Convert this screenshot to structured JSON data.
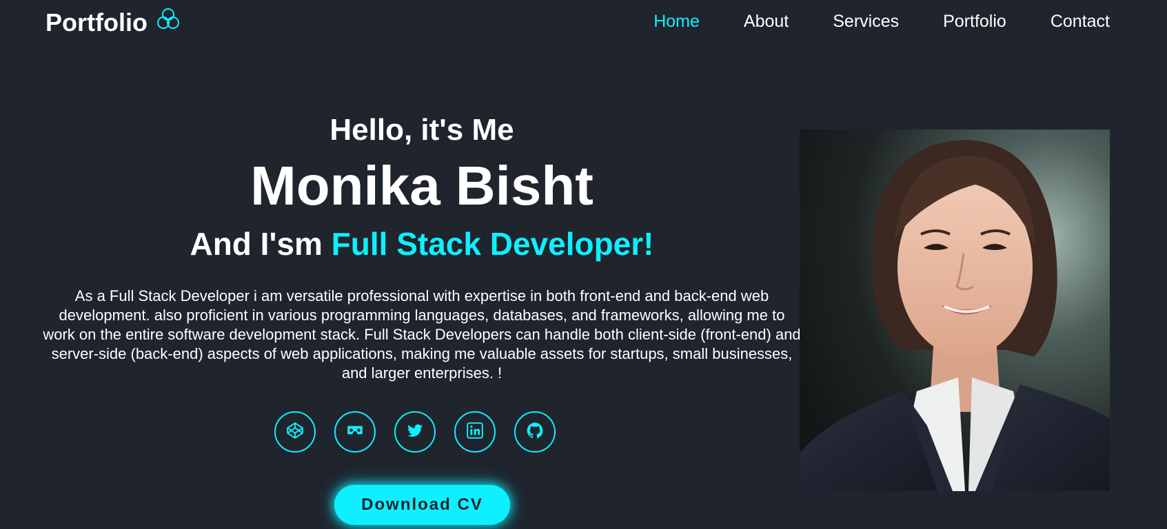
{
  "header": {
    "logo_text": "Portfolio",
    "logo_icon": "codepen-knot-icon",
    "nav": [
      {
        "label": "Home",
        "active": true
      },
      {
        "label": "About",
        "active": false
      },
      {
        "label": "Services",
        "active": false
      },
      {
        "label": "Portfolio",
        "active": false
      },
      {
        "label": "Contact",
        "active": false
      }
    ]
  },
  "hero": {
    "greeting": "Hello, it's Me",
    "name": "Monika Bisht",
    "role_prefix": "And I'sm",
    "role_highlight": "Full Stack Developer!",
    "description": "As a Full Stack Developer i am versatile professional with expertise in both front-end and back-end web development. also proficient in various programming languages, databases, and frameworks, allowing me to work on the entire software development stack. Full Stack Developers can handle both client-side (front-end) and server-side (back-end) aspects of web applications, making me valuable assets for startups, small businesses, and larger enterprises. !",
    "socials": [
      "codepen-icon",
      "vr-cardboard-icon",
      "twitter-icon",
      "linkedin-icon",
      "github-icon"
    ],
    "cta_label": "Download CV"
  },
  "portrait": {
    "alt": "Portrait of Monika Bisht"
  },
  "colors": {
    "background": "#1f242d",
    "accent": "#0ef0ff",
    "text": "#ffffff"
  }
}
